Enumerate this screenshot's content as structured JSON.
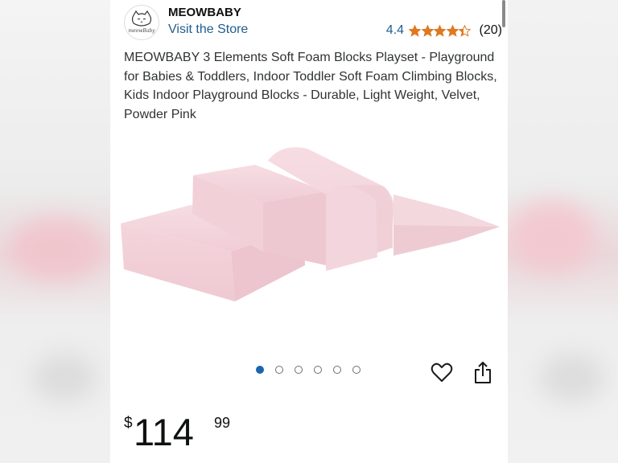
{
  "store": {
    "brand": "MEOWBABY",
    "visit_link": "Visit the Store",
    "logo_text": "meowBaby"
  },
  "rating": {
    "value": "4.4",
    "stars": 4.4,
    "count": "(20)"
  },
  "product": {
    "title": "MEOWBABY 3 Elements Soft Foam Blocks Playset - Playground for Babies & Toddlers, Indoor Toddler Soft Foam Climbing Blocks, Kids Indoor Playground Blocks - Durable, Light Weight, Velvet, Powder Pink",
    "image_icon": "foam-blocks-product-image"
  },
  "carousel": {
    "total": 6,
    "active": 1
  },
  "actions": {
    "favorite_icon": "heart-icon",
    "share_icon": "share-icon"
  },
  "price": {
    "currency": "$",
    "whole": "114",
    "fraction": "99"
  },
  "colors": {
    "link": "#1f5e8e",
    "star": "#de7921",
    "active_dot": "#1a66b0",
    "product_pink": "#f3d3db"
  }
}
